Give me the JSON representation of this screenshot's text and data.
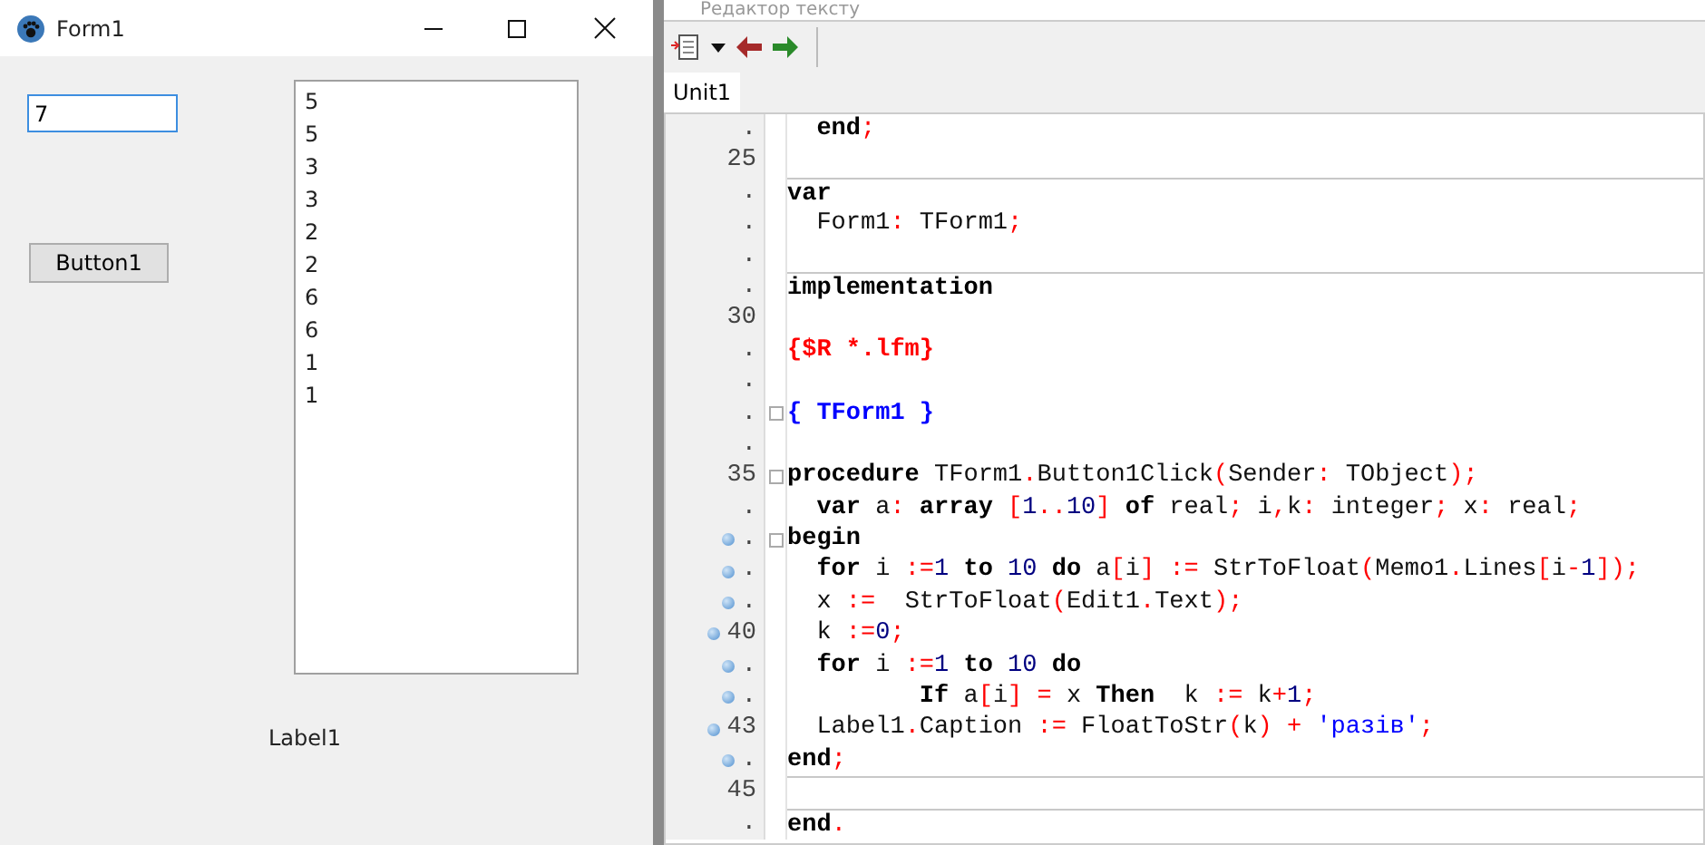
{
  "form_window": {
    "title": "Form1",
    "edit": {
      "value": "7",
      "focused": true
    },
    "button": "Button1",
    "memo": {
      "lines": [
        "5",
        "5",
        "3",
        "3",
        "2",
        "2",
        "6",
        "6",
        "1",
        "1"
      ]
    },
    "label": "Label1"
  },
  "editor_window": {
    "title": "Редактор тексту",
    "tabs": [
      {
        "label": "Unit1",
        "selected": true
      }
    ],
    "code_lines": [
      {
        "number": ".",
        "breakpoint": false,
        "fold": false,
        "divider_above": false,
        "tokens": [
          {
            "kind": "kw",
            "text": "  end"
          },
          {
            "kind": "sym",
            "text": ";"
          }
        ]
      },
      {
        "number": "25",
        "breakpoint": false,
        "fold": false,
        "divider_above": false
      },
      {
        "number": ".",
        "breakpoint": false,
        "fold": false,
        "divider_above": true,
        "tokens": [
          {
            "kind": "kw",
            "text": "var"
          }
        ]
      },
      {
        "number": ".",
        "breakpoint": false,
        "fold": false,
        "divider_above": false,
        "tokens": [
          {
            "kind": "id",
            "text": "  Form1"
          },
          {
            "kind": "sym",
            "text": ":"
          },
          {
            "kind": "id",
            "text": " TForm1"
          },
          {
            "kind": "sym",
            "text": ";"
          }
        ]
      },
      {
        "number": ".",
        "breakpoint": false,
        "fold": false,
        "divider_above": false
      },
      {
        "number": ".",
        "breakpoint": false,
        "fold": false,
        "divider_above": true,
        "tokens": [
          {
            "kind": "kw",
            "text": "implementation"
          }
        ]
      },
      {
        "number": "30",
        "breakpoint": false,
        "fold": false,
        "divider_above": false
      },
      {
        "number": ".",
        "breakpoint": false,
        "fold": false,
        "divider_above": false,
        "tokens": [
          {
            "kind": "dir",
            "text": "{$R *.lfm}"
          }
        ]
      },
      {
        "number": ".",
        "breakpoint": false,
        "fold": false,
        "divider_above": false
      },
      {
        "number": ".",
        "breakpoint": false,
        "fold": true,
        "divider_above": false,
        "tokens": [
          {
            "kind": "com",
            "text": "{ TForm1 }"
          }
        ]
      },
      {
        "number": ".",
        "breakpoint": false,
        "fold": false,
        "divider_above": false
      },
      {
        "number": "35",
        "breakpoint": false,
        "fold": true,
        "divider_above": false,
        "tokens": [
          {
            "kind": "kw",
            "text": "procedure"
          },
          {
            "kind": "id",
            "text": " TForm1"
          },
          {
            "kind": "sym",
            "text": "."
          },
          {
            "kind": "id",
            "text": "Button1Click"
          },
          {
            "kind": "sym",
            "text": "("
          },
          {
            "kind": "id",
            "text": "Sender"
          },
          {
            "kind": "sym",
            "text": ":"
          },
          {
            "kind": "id",
            "text": " TObject"
          },
          {
            "kind": "sym",
            "text": ");"
          }
        ]
      },
      {
        "number": ".",
        "breakpoint": false,
        "fold": false,
        "divider_above": false,
        "tokens": [
          {
            "kind": "kw",
            "text": "  var"
          },
          {
            "kind": "id",
            "text": " a"
          },
          {
            "kind": "sym",
            "text": ":"
          },
          {
            "kind": "kw",
            "text": " array"
          },
          {
            "kind": "sym",
            "text": " ["
          },
          {
            "kind": "num",
            "text": "1"
          },
          {
            "kind": "sym",
            "text": ".."
          },
          {
            "kind": "num",
            "text": "10"
          },
          {
            "kind": "sym",
            "text": "]"
          },
          {
            "kind": "kw",
            "text": " of"
          },
          {
            "kind": "id",
            "text": " real"
          },
          {
            "kind": "sym",
            "text": ";"
          },
          {
            "kind": "id",
            "text": " i"
          },
          {
            "kind": "sym",
            "text": ","
          },
          {
            "kind": "id",
            "text": "k"
          },
          {
            "kind": "sym",
            "text": ":"
          },
          {
            "kind": "id",
            "text": " integer"
          },
          {
            "kind": "sym",
            "text": ";"
          },
          {
            "kind": "id",
            "text": " x"
          },
          {
            "kind": "sym",
            "text": ":"
          },
          {
            "kind": "id",
            "text": " real"
          },
          {
            "kind": "sym",
            "text": ";"
          }
        ]
      },
      {
        "number": ".",
        "breakpoint": true,
        "fold": true,
        "divider_above": false,
        "tokens": [
          {
            "kind": "kw",
            "text": "begin"
          }
        ]
      },
      {
        "number": ".",
        "breakpoint": true,
        "fold": false,
        "divider_above": false,
        "tokens": [
          {
            "kind": "kw",
            "text": "  for"
          },
          {
            "kind": "id",
            "text": " i"
          },
          {
            "kind": "sym",
            "text": " :="
          },
          {
            "kind": "num",
            "text": "1"
          },
          {
            "kind": "kw",
            "text": " to"
          },
          {
            "kind": "num",
            "text": " 10"
          },
          {
            "kind": "kw",
            "text": " do"
          },
          {
            "kind": "id",
            "text": " a"
          },
          {
            "kind": "sym",
            "text": "["
          },
          {
            "kind": "id",
            "text": "i"
          },
          {
            "kind": "sym",
            "text": "] :="
          },
          {
            "kind": "id",
            "text": " StrToFloat"
          },
          {
            "kind": "sym",
            "text": "("
          },
          {
            "kind": "id",
            "text": "Memo1"
          },
          {
            "kind": "sym",
            "text": "."
          },
          {
            "kind": "id",
            "text": "Lines"
          },
          {
            "kind": "sym",
            "text": "["
          },
          {
            "kind": "id",
            "text": "i"
          },
          {
            "kind": "sym",
            "text": "-"
          },
          {
            "kind": "num",
            "text": "1"
          },
          {
            "kind": "sym",
            "text": "]);"
          }
        ]
      },
      {
        "number": ".",
        "breakpoint": true,
        "fold": false,
        "divider_above": false,
        "tokens": [
          {
            "kind": "id",
            "text": "  x"
          },
          {
            "kind": "sym",
            "text": " :="
          },
          {
            "kind": "id",
            "text": "  StrToFloat"
          },
          {
            "kind": "sym",
            "text": "("
          },
          {
            "kind": "id",
            "text": "Edit1"
          },
          {
            "kind": "sym",
            "text": "."
          },
          {
            "kind": "id",
            "text": "Text"
          },
          {
            "kind": "sym",
            "text": ");"
          }
        ]
      },
      {
        "number": "40",
        "breakpoint": true,
        "fold": false,
        "divider_above": false,
        "tokens": [
          {
            "kind": "id",
            "text": "  k"
          },
          {
            "kind": "sym",
            "text": " :="
          },
          {
            "kind": "num",
            "text": "0"
          },
          {
            "kind": "sym",
            "text": ";"
          }
        ]
      },
      {
        "number": ".",
        "breakpoint": true,
        "fold": false,
        "divider_above": false,
        "tokens": [
          {
            "kind": "kw",
            "text": "  for"
          },
          {
            "kind": "id",
            "text": " i"
          },
          {
            "kind": "sym",
            "text": " :="
          },
          {
            "kind": "num",
            "text": "1"
          },
          {
            "kind": "kw",
            "text": " to"
          },
          {
            "kind": "num",
            "text": " 10"
          },
          {
            "kind": "kw",
            "text": " do"
          }
        ]
      },
      {
        "number": ".",
        "breakpoint": true,
        "fold": false,
        "divider_above": false,
        "tokens": [
          {
            "kind": "kw",
            "text": "         If"
          },
          {
            "kind": "id",
            "text": " a"
          },
          {
            "kind": "sym",
            "text": "["
          },
          {
            "kind": "id",
            "text": "i"
          },
          {
            "kind": "sym",
            "text": "] ="
          },
          {
            "kind": "id",
            "text": " x"
          },
          {
            "kind": "kw",
            "text": " Then"
          },
          {
            "kind": "id",
            "text": "  k"
          },
          {
            "kind": "sym",
            "text": " :="
          },
          {
            "kind": "id",
            "text": " k"
          },
          {
            "kind": "sym",
            "text": "+"
          },
          {
            "kind": "num",
            "text": "1"
          },
          {
            "kind": "sym",
            "text": ";"
          }
        ]
      },
      {
        "number": "43",
        "breakpoint": true,
        "fold": false,
        "divider_above": false,
        "tokens": [
          {
            "kind": "id",
            "text": "  Label1"
          },
          {
            "kind": "sym",
            "text": "."
          },
          {
            "kind": "id",
            "text": "Caption"
          },
          {
            "kind": "sym",
            "text": " :="
          },
          {
            "kind": "id",
            "text": " FloatToStr"
          },
          {
            "kind": "sym",
            "text": "("
          },
          {
            "kind": "id",
            "text": "k"
          },
          {
            "kind": "sym",
            "text": ") +"
          },
          {
            "kind": "str",
            "text": " 'разів'"
          },
          {
            "kind": "sym",
            "text": ";"
          }
        ]
      },
      {
        "number": ".",
        "breakpoint": true,
        "fold": false,
        "divider_above": false,
        "tokens": [
          {
            "kind": "kw",
            "text": "end"
          },
          {
            "kind": "sym",
            "text": ";"
          }
        ]
      },
      {
        "number": "45",
        "breakpoint": false,
        "fold": false,
        "divider_above": true
      },
      {
        "number": ".",
        "breakpoint": false,
        "fold": false,
        "divider_above": true,
        "tokens": [
          {
            "kind": "kw",
            "text": "end"
          },
          {
            "kind": "sym",
            "text": "."
          }
        ]
      }
    ]
  }
}
